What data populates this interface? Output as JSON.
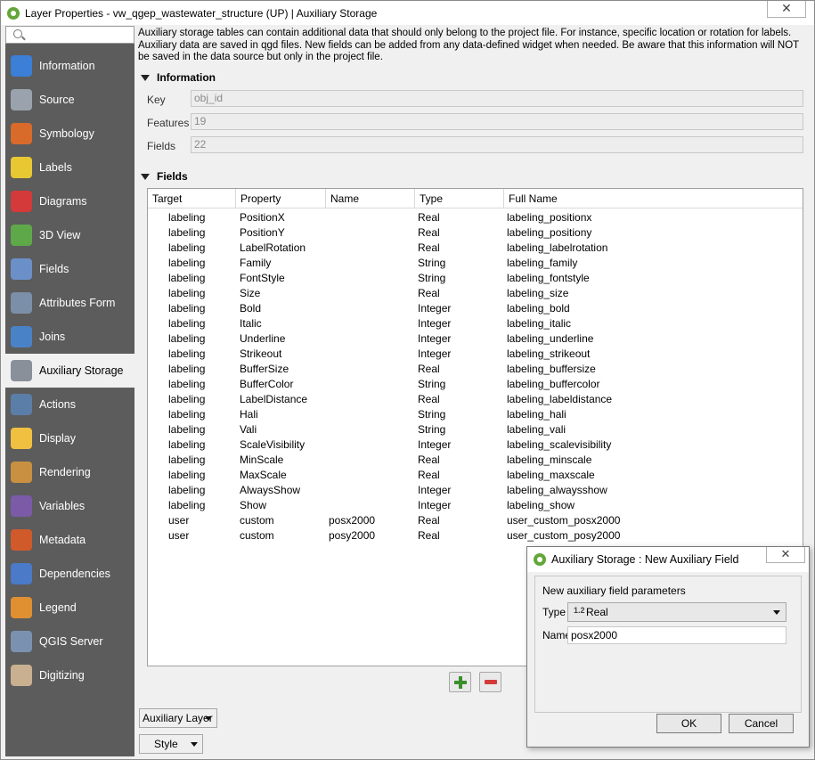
{
  "window": {
    "title": "Layer Properties - vw_qgep_wastewater_structure (UP) | Auxiliary Storage",
    "close_glyph": "✕"
  },
  "sidebar": {
    "items": [
      {
        "label": "Information",
        "icon": "info-icon",
        "color": "#3b7fd6"
      },
      {
        "label": "Source",
        "icon": "gear-icon",
        "color": "#9aa3ad"
      },
      {
        "label": "Symbology",
        "icon": "paintbrush-icon",
        "color": "#d86a2a"
      },
      {
        "label": "Labels",
        "icon": "abc-label-icon",
        "color": "#e8c832"
      },
      {
        "label": "Diagrams",
        "icon": "diagram-icon",
        "color": "#d43a3a"
      },
      {
        "label": "3D View",
        "icon": "cube-icon",
        "color": "#5fa84a"
      },
      {
        "label": "Fields",
        "icon": "fields-icon",
        "color": "#6b90c8"
      },
      {
        "label": "Attributes Form",
        "icon": "form-icon",
        "color": "#7b8fa8"
      },
      {
        "label": "Joins",
        "icon": "joins-icon",
        "color": "#4a82c8"
      },
      {
        "label": "Auxiliary Storage",
        "icon": "database-icon",
        "color": "#8a9099"
      },
      {
        "label": "Actions",
        "icon": "actions-icon",
        "color": "#5b7ea8"
      },
      {
        "label": "Display",
        "icon": "speech-bubble-icon",
        "color": "#f0c040"
      },
      {
        "label": "Rendering",
        "icon": "brush-icon",
        "color": "#c89040"
      },
      {
        "label": "Variables",
        "icon": "epsilon-icon",
        "color": "#7b5aa8"
      },
      {
        "label": "Metadata",
        "icon": "metadata-icon",
        "color": "#d05a2a"
      },
      {
        "label": "Dependencies",
        "icon": "dependencies-icon",
        "color": "#4a7ac8"
      },
      {
        "label": "Legend",
        "icon": "legend-icon",
        "color": "#e09030"
      },
      {
        "label": "QGIS Server",
        "icon": "server-icon",
        "color": "#7a92b0"
      },
      {
        "label": "Digitizing",
        "icon": "digitizing-icon",
        "color": "#c8b090"
      }
    ],
    "active_index": 9
  },
  "description": "Auxiliary storage tables can contain additional data that should only belong to the project file. For instance, specific location or rotation for labels. Auxiliary data are saved in qgd files. New fields can be added from any data-defined widget when needed. Be aware that this information will NOT be saved in the data source but only in the project file.",
  "information": {
    "header": "Information",
    "key_label": "Key",
    "key_value": "obj_id",
    "features_label": "Features",
    "features_value": "19",
    "fields_label": "Fields",
    "fields_value": "22"
  },
  "fields_section": {
    "header": "Fields",
    "columns": [
      "Target",
      "Property",
      "Name",
      "Type",
      "Full Name"
    ],
    "rows": [
      [
        "labeling",
        "PositionX",
        "",
        "Real",
        "labeling_positionx"
      ],
      [
        "labeling",
        "PositionY",
        "",
        "Real",
        "labeling_positiony"
      ],
      [
        "labeling",
        "LabelRotation",
        "",
        "Real",
        "labeling_labelrotation"
      ],
      [
        "labeling",
        "Family",
        "",
        "String",
        "labeling_family"
      ],
      [
        "labeling",
        "FontStyle",
        "",
        "String",
        "labeling_fontstyle"
      ],
      [
        "labeling",
        "Size",
        "",
        "Real",
        "labeling_size"
      ],
      [
        "labeling",
        "Bold",
        "",
        "Integer",
        "labeling_bold"
      ],
      [
        "labeling",
        "Italic",
        "",
        "Integer",
        "labeling_italic"
      ],
      [
        "labeling",
        "Underline",
        "",
        "Integer",
        "labeling_underline"
      ],
      [
        "labeling",
        "Strikeout",
        "",
        "Integer",
        "labeling_strikeout"
      ],
      [
        "labeling",
        "BufferSize",
        "",
        "Real",
        "labeling_buffersize"
      ],
      [
        "labeling",
        "BufferColor",
        "",
        "String",
        "labeling_buffercolor"
      ],
      [
        "labeling",
        "LabelDistance",
        "",
        "Real",
        "labeling_labeldistance"
      ],
      [
        "labeling",
        "Hali",
        "",
        "String",
        "labeling_hali"
      ],
      [
        "labeling",
        "Vali",
        "",
        "String",
        "labeling_vali"
      ],
      [
        "labeling",
        "ScaleVisibility",
        "",
        "Integer",
        "labeling_scalevisibility"
      ],
      [
        "labeling",
        "MinScale",
        "",
        "Real",
        "labeling_minscale"
      ],
      [
        "labeling",
        "MaxScale",
        "",
        "Real",
        "labeling_maxscale"
      ],
      [
        "labeling",
        "AlwaysShow",
        "",
        "Integer",
        "labeling_alwaysshow"
      ],
      [
        "labeling",
        "Show",
        "",
        "Integer",
        "labeling_show"
      ],
      [
        "user",
        "custom",
        "posx2000",
        "Real",
        "user_custom_posx2000"
      ],
      [
        "user",
        "custom",
        "posy2000",
        "Real",
        "user_custom_posy2000"
      ]
    ]
  },
  "bottom": {
    "auxiliary_layer_label": "Auxiliary Layer",
    "style_label": "Style"
  },
  "dialog": {
    "title": "Auxiliary Storage : New Auxiliary Field",
    "close_glyph": "✕",
    "subtitle": "New auxiliary field parameters",
    "type_label": "Type",
    "type_badge": "1.2",
    "type_value": "Real",
    "name_label": "Name",
    "name_value": "posx2000",
    "ok_label": "OK",
    "cancel_label": "Cancel"
  }
}
